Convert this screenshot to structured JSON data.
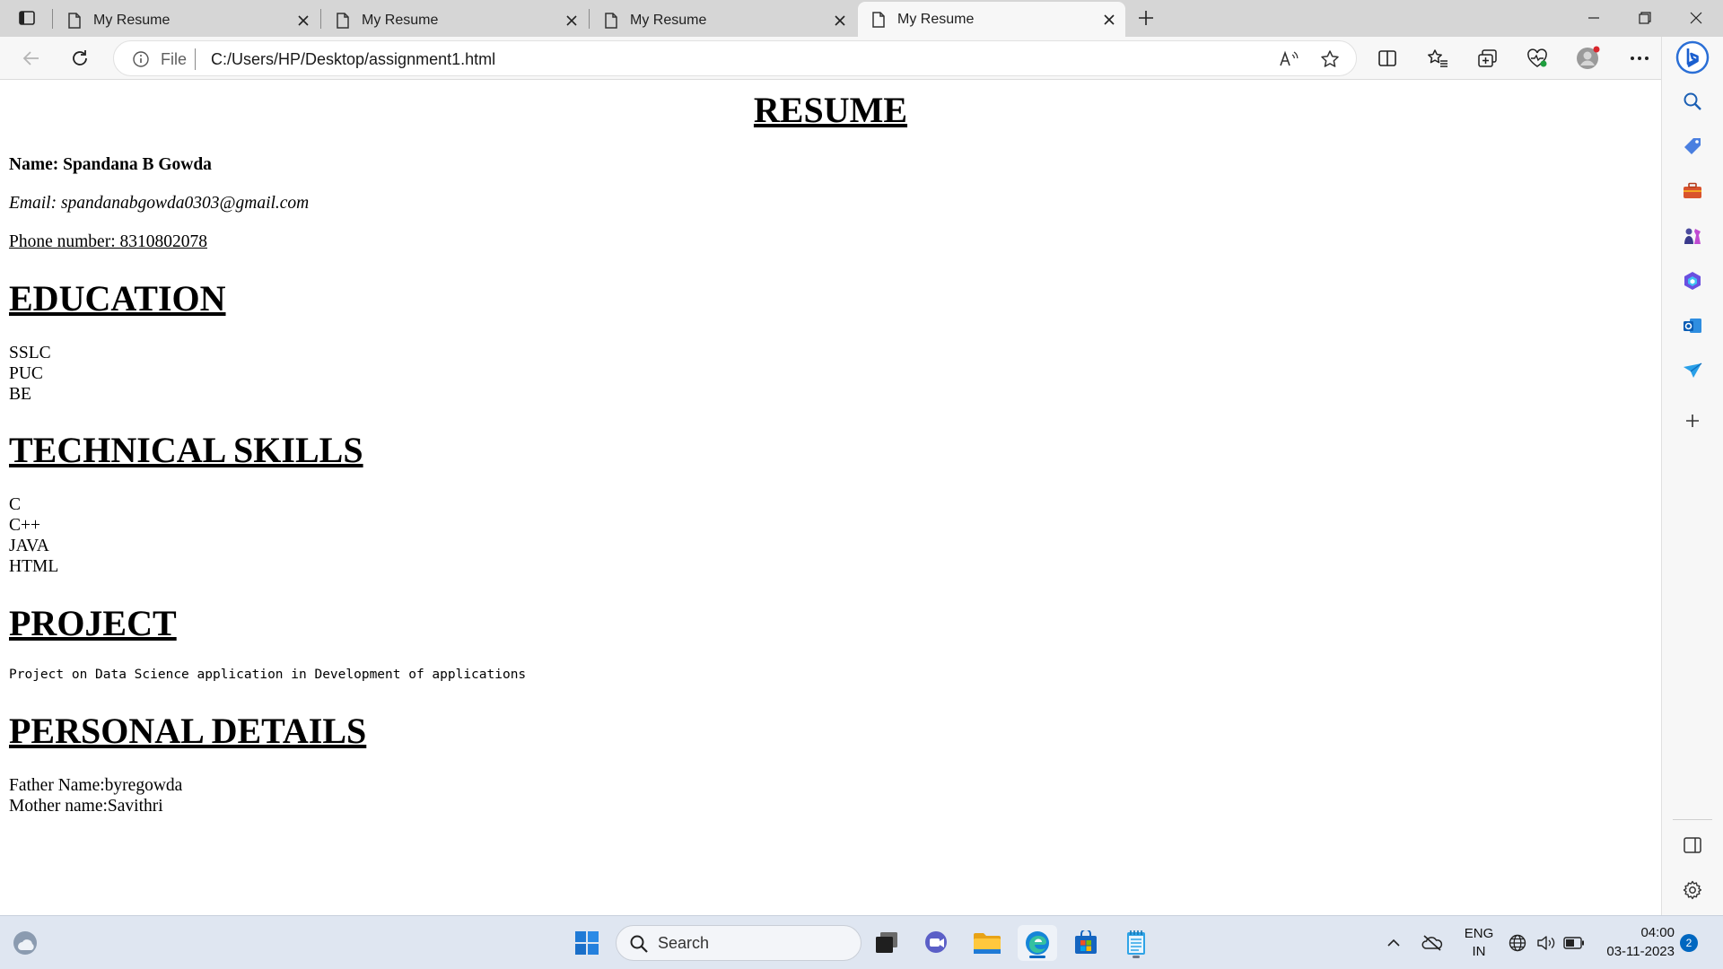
{
  "browser": {
    "tabs": [
      {
        "title": "My Resume",
        "active": false
      },
      {
        "title": "My Resume",
        "active": false
      },
      {
        "title": "My Resume",
        "active": false
      },
      {
        "title": "My Resume",
        "active": true
      }
    ],
    "address": {
      "scheme_label": "File",
      "url": "C:/Users/HP/Desktop/assignment1.html"
    }
  },
  "resume": {
    "title": "RESUME",
    "name_line": "Name: Spandana B Gowda",
    "email_line": "Email: spandanabgowda0303@gmail.com",
    "phone_line": "Phone number: 8310802078",
    "education_heading": "EDUCATION",
    "education": [
      "SSLC",
      "PUC",
      "BE"
    ],
    "skills_heading": "TECHNICAL SKILLS",
    "skills": [
      "C",
      "C++",
      "JAVA",
      "HTML"
    ],
    "project_heading": "PROJECT",
    "project_text": "Project on Data Science application in Development of applications",
    "personal_heading": "PERSONAL DETAILS",
    "father_line": "Father Name:byregowda",
    "mother_line": "Mother name:Savithri"
  },
  "taskbar": {
    "search_placeholder": "Search",
    "language_top": "ENG",
    "language_bottom": "IN",
    "time": "04:00",
    "date": "03-11-2023",
    "notification_count": "2"
  },
  "colors": {
    "tabstrip_bg": "#d6d6d6",
    "toolbar_bg": "#f7f7f7",
    "taskbar_bg": "#dfe6f1",
    "accent": "#0067c0"
  }
}
